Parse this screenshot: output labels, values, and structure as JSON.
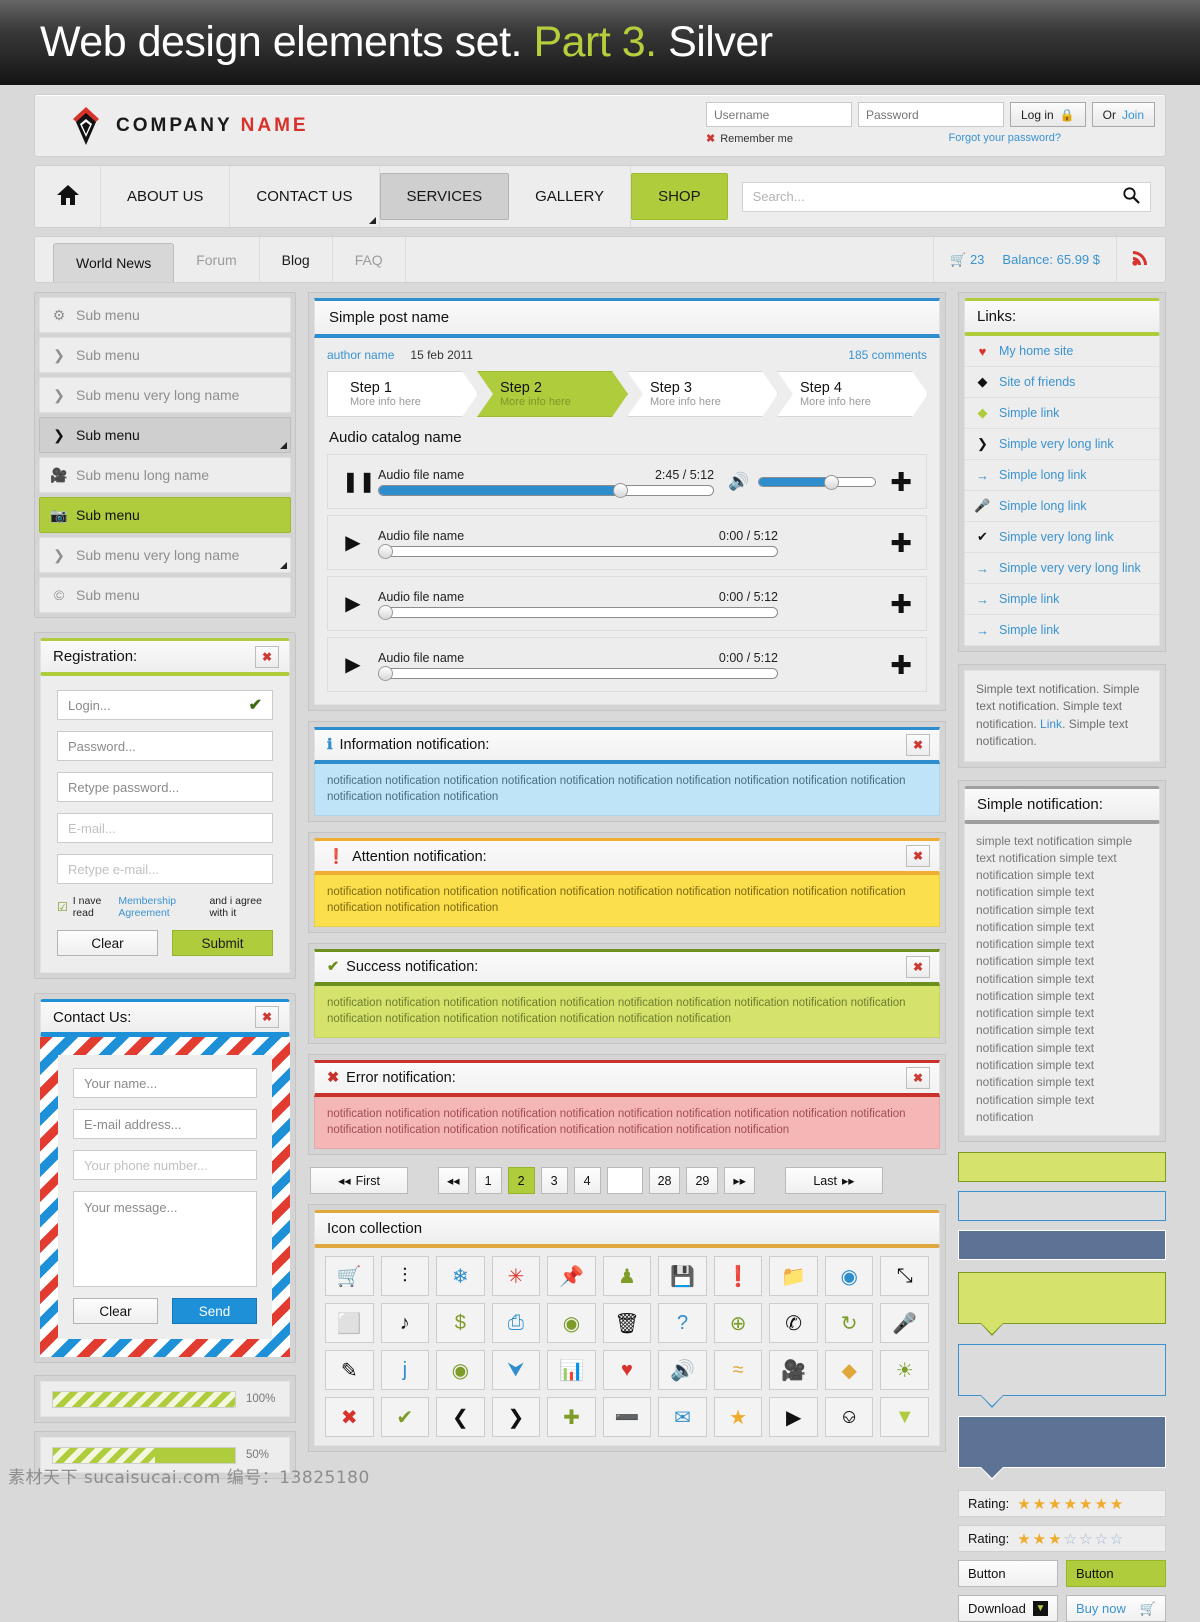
{
  "banner": {
    "main": "Web design elements set.",
    "accent": "Part 3.",
    "tail": "Silver"
  },
  "header": {
    "company_first": "COMPANY",
    "company_second": "NAME",
    "username_placeholder": "Username",
    "password_placeholder": "Password",
    "login_label": "Log in",
    "or_label": "Or",
    "join_label": "Join",
    "remember_label": "Remember me",
    "forgot_label": "Forgot your password?"
  },
  "nav": {
    "home_icon": "home-icon",
    "items": [
      {
        "label": "ABOUT US",
        "state": "normal"
      },
      {
        "label": "CONTACT US",
        "state": "dropdown"
      },
      {
        "label": "SERVICES",
        "state": "active-grey"
      },
      {
        "label": "GALLERY",
        "state": "normal"
      },
      {
        "label": "SHOP",
        "state": "active-green"
      }
    ],
    "search_placeholder": "Search..."
  },
  "tabs": {
    "items": [
      {
        "label": "World News",
        "state": "selected"
      },
      {
        "label": "Forum",
        "state": "muted"
      },
      {
        "label": "Blog",
        "state": "dark"
      },
      {
        "label": "FAQ",
        "state": "muted"
      }
    ],
    "cart_count": "23",
    "balance": "Balance: 65.99 $"
  },
  "sidebar": {
    "items": [
      {
        "label": "Sub menu",
        "icon": "gear-icon",
        "state": "normal"
      },
      {
        "label": "Sub menu",
        "icon": "chevron-right-icon",
        "state": "normal"
      },
      {
        "label": "Sub menu very long name",
        "icon": "chevron-right-icon",
        "state": "normal"
      },
      {
        "label": "Sub menu",
        "icon": "chevron-right-icon",
        "state": "active"
      },
      {
        "label": "Sub menu long name",
        "icon": "video-camera-icon",
        "state": "normal"
      },
      {
        "label": "Sub menu",
        "icon": "camera-icon",
        "state": "green"
      },
      {
        "label": "Sub menu very long name",
        "icon": "chevron-right-icon",
        "state": "submenu"
      },
      {
        "label": "Sub menu",
        "icon": "copyright-icon",
        "state": "normal"
      }
    ]
  },
  "registration": {
    "title": "Registration:",
    "close_icon": "close-icon",
    "fields": [
      {
        "placeholder": "Login...",
        "valid": true
      },
      {
        "placeholder": "Password...",
        "valid": false
      },
      {
        "placeholder": "Retype password...",
        "valid": false
      },
      {
        "placeholder": "E-mail...",
        "valid": false,
        "light": true
      },
      {
        "placeholder": "Retype e-mail...",
        "valid": false,
        "light": true
      }
    ],
    "agree_pre": "I nave read",
    "agree_link": "Membership Agreement",
    "agree_post": "and i agree with it",
    "clear_label": "Clear",
    "submit_label": "Submit"
  },
  "contact": {
    "title": "Contact Us:",
    "close_icon": "close-icon",
    "name_placeholder": "Your name...",
    "email_placeholder": "E-mail address...",
    "phone_placeholder": "Your phone number...",
    "message_placeholder": "Your message...",
    "clear_label": "Clear",
    "send_label": "Send"
  },
  "progress": [
    {
      "percent": 100,
      "label": "100%",
      "style": "stripe"
    },
    {
      "percent": 50,
      "label": "50%",
      "style": "mixed"
    }
  ],
  "post": {
    "title": "Simple post name",
    "author": "author name",
    "date": "15 feb 2011",
    "comments": "185 comments",
    "steps": [
      {
        "title": "Step 1",
        "sub": "More info here",
        "active": false
      },
      {
        "title": "Step 2",
        "sub": "More info here",
        "active": true
      },
      {
        "title": "Step 3",
        "sub": "More info here",
        "active": false
      },
      {
        "title": "Step 4",
        "sub": "More info here",
        "active": false
      }
    ],
    "audio_title": "Audio catalog name",
    "audio": [
      {
        "name": "Audio file name",
        "time": "2:45 / 5:12",
        "progress": 72,
        "playing": true,
        "volume": 62
      },
      {
        "name": "Audio file name",
        "time": "0:00 / 5:12",
        "progress": 0,
        "playing": false
      },
      {
        "name": "Audio file name",
        "time": "0:00 / 5:12",
        "progress": 0,
        "playing": false
      },
      {
        "name": "Audio file name",
        "time": "0:00 / 5:12",
        "progress": 0,
        "playing": false
      }
    ]
  },
  "notifications": [
    {
      "kind": "info",
      "icon": "info-icon",
      "title": "Information notification:",
      "body": "notification notification notification notification notification notification notification notification notification notification notification notification notification"
    },
    {
      "kind": "warn",
      "icon": "exclamation-icon",
      "title": "Attention notification:",
      "body": "notification notification notification notification notification notification notification notification notification notification notification notification notification"
    },
    {
      "kind": "ok",
      "icon": "check-icon",
      "title": "Success notification:",
      "body": "notification notification notification notification notification notification notification notification notification notification notification notification notification notification notification notification notification"
    },
    {
      "kind": "err",
      "icon": "cross-icon",
      "title": "Error notification:",
      "body": "notification notification notification notification notification notification notification notification notification notification notification notification notification notification notification notification notification notification"
    }
  ],
  "pagination": {
    "first_label": "First",
    "last_label": "Last",
    "prev_label": "◂◂",
    "next_label": "▸▸",
    "pages": [
      "1",
      "2",
      "3",
      "4",
      "",
      "28",
      "29"
    ],
    "current": "2"
  },
  "icon_collection": {
    "title": "Icon collection",
    "icons": [
      {
        "name": "shopping-cart-icon",
        "glyph": "🛒",
        "color": "#2e8dcc"
      },
      {
        "name": "equalizer-icon",
        "glyph": "⫶",
        "color": "#111"
      },
      {
        "name": "snowflake-icon",
        "glyph": "❄",
        "color": "#2e8dcc"
      },
      {
        "name": "asterisk-icon",
        "glyph": "✳",
        "color": "#e0372c"
      },
      {
        "name": "pushpin-icon",
        "glyph": "📌",
        "color": "#111"
      },
      {
        "name": "user-icon",
        "glyph": "♟",
        "color": "#7d9c2a"
      },
      {
        "name": "save-icon",
        "glyph": "💾",
        "color": "#111"
      },
      {
        "name": "exclamation-icon",
        "glyph": "❗",
        "color": "#e0372c"
      },
      {
        "name": "folder-icon",
        "glyph": "📁",
        "color": "#e0a83c"
      },
      {
        "name": "disc-icon",
        "glyph": "◉",
        "color": "#2e8dcc"
      },
      {
        "name": "fullscreen-icon",
        "glyph": "⤡",
        "color": "#111"
      },
      {
        "name": "gamepad-icon",
        "glyph": "⬜",
        "color": "#2e8dcc"
      },
      {
        "name": "music-note-icon",
        "glyph": "♪",
        "color": "#111"
      },
      {
        "name": "dollar-icon",
        "glyph": "$",
        "color": "#7d9c2a"
      },
      {
        "name": "printer-icon",
        "glyph": "⎙",
        "color": "#2e8dcc"
      },
      {
        "name": "eye-icon",
        "glyph": "◉",
        "color": "#7d9c2a"
      },
      {
        "name": "trash-icon",
        "glyph": "🗑",
        "color": "#111"
      },
      {
        "name": "question-icon",
        "glyph": "?",
        "color": "#2e8dcc"
      },
      {
        "name": "globe-icon",
        "glyph": "⊕",
        "color": "#7d9c2a"
      },
      {
        "name": "phone-icon",
        "glyph": "✆",
        "color": "#111"
      },
      {
        "name": "refresh-icon",
        "glyph": "↻",
        "color": "#7d9c2a"
      },
      {
        "name": "microphone-icon",
        "glyph": "🎤",
        "color": "#111"
      },
      {
        "name": "pencil-icon",
        "glyph": "✎",
        "color": "#111"
      },
      {
        "name": "info-icon",
        "glyph": "j",
        "color": "#2e8dcc"
      },
      {
        "name": "camera-icon",
        "glyph": "◉",
        "color": "#7d9c2a"
      },
      {
        "name": "tag-icon",
        "glyph": "⮟",
        "color": "#2e8dcc"
      },
      {
        "name": "bar-chart-icon",
        "glyph": "📊",
        "color": "#2e8dcc"
      },
      {
        "name": "heart-icon",
        "glyph": "♥",
        "color": "#d8322c"
      },
      {
        "name": "speaker-icon",
        "glyph": "🔊",
        "color": "#111"
      },
      {
        "name": "rss-icon",
        "glyph": "≈",
        "color": "#e0a83c"
      },
      {
        "name": "video-camera-icon",
        "glyph": "🎥",
        "color": "#111"
      },
      {
        "name": "shield-icon",
        "glyph": "◆",
        "color": "#e0a83c"
      },
      {
        "name": "lightbulb-icon",
        "glyph": "☀",
        "color": "#7d9c2a"
      },
      {
        "name": "cross-icon",
        "glyph": "✖",
        "color": "#d8322c"
      },
      {
        "name": "check-icon",
        "glyph": "✔",
        "color": "#7d9c2a"
      },
      {
        "name": "chevron-left-icon",
        "glyph": "❮",
        "color": "#111"
      },
      {
        "name": "chevron-right-icon",
        "glyph": "❯",
        "color": "#111"
      },
      {
        "name": "plus-icon",
        "glyph": "✚",
        "color": "#7d9c2a"
      },
      {
        "name": "minus-icon",
        "glyph": "➖",
        "color": "#d8322c"
      },
      {
        "name": "mail-icon",
        "glyph": "✉",
        "color": "#2e8dcc"
      },
      {
        "name": "star-icon",
        "glyph": "★",
        "color": "#efab2a"
      },
      {
        "name": "play-icon",
        "glyph": "▶",
        "color": "#111"
      },
      {
        "name": "pause-icon",
        "glyph": "⎉",
        "color": "#111"
      },
      {
        "name": "download-badge-icon",
        "glyph": "▼",
        "color": "#aecc3c"
      }
    ]
  },
  "links": {
    "title": "Links:",
    "items": [
      {
        "label": "My home site",
        "icon": "heart-icon",
        "glyph": "♥",
        "color": "#d8322c"
      },
      {
        "label": "Site of friends",
        "icon": "diamond-logo-icon",
        "glyph": "◆",
        "color": "#111"
      },
      {
        "label": "Simple link",
        "icon": "shield-icon",
        "glyph": "◆",
        "color": "#aecc3c"
      },
      {
        "label": "Simple very long link",
        "icon": "chevron-right-icon",
        "glyph": "❯",
        "color": "#111"
      },
      {
        "label": "Simple long link",
        "icon": "arrow-right-icon",
        "glyph": "→",
        "color": "#2e8dcc"
      },
      {
        "label": "Simple long link",
        "icon": "microphone-icon",
        "glyph": "🎤",
        "color": "#e0a83c"
      },
      {
        "label": "Simple very long link",
        "icon": "check-icon",
        "glyph": "✔",
        "color": "#111"
      },
      {
        "label": "Simple very very long link",
        "icon": "arrow-right-icon",
        "glyph": "→",
        "color": "#2e8dcc"
      },
      {
        "label": "Simple link",
        "icon": "arrow-right-icon",
        "glyph": "→",
        "color": "#2e8dcc"
      },
      {
        "label": "Simple link",
        "icon": "arrow-right-icon",
        "glyph": "→",
        "color": "#2e8dcc"
      }
    ]
  },
  "side_text": {
    "part1": "Simple text notification. Simple text notification. Simple text notification. ",
    "link": "Link",
    "part2": ". Simple text notification."
  },
  "simple_notification": {
    "title": "Simple notification:",
    "body": "simple text notification simple text notification simple text notification simple text notification simple text notification simple text notification simple text notification simple text notification simple text notification simple text notification simple text notification simple text notification simple text notification simple text notification simple text notification simple text notification simple text notification"
  },
  "ratings": [
    {
      "label": "Rating:",
      "filled": 7,
      "total": 7
    },
    {
      "label": "Rating:",
      "filled": 3,
      "total": 7
    }
  ],
  "side_buttons": {
    "button_plain": "Button",
    "button_green": "Button",
    "download_label": "Download",
    "buy_label": "Buy now"
  },
  "watermark": "素材天下 sucaisucai.com  编号：13825180",
  "colors": {
    "green": "#aecc3c",
    "blue": "#2e8dcc",
    "red": "#d8322c",
    "orange": "#e0a83c",
    "dark": "#1a1a1a"
  }
}
